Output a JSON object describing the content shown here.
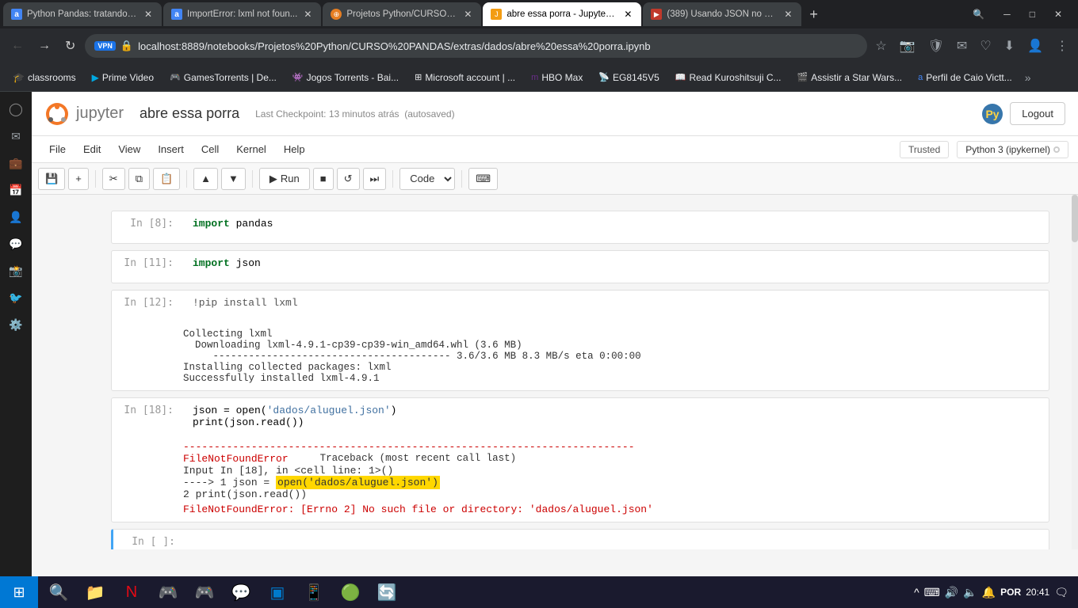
{
  "browser": {
    "tabs": [
      {
        "id": 1,
        "title": "Python Pandas: tratando e...",
        "favicon_color": "#4285f4",
        "active": false,
        "favicon_letter": "a"
      },
      {
        "id": 2,
        "title": "ImportError: lxml not foun...",
        "favicon_color": "#4285f4",
        "active": false,
        "favicon_letter": "a"
      },
      {
        "id": 3,
        "title": "Projetos Python/CURSO PA...",
        "favicon_color": "#e67e22",
        "active": false,
        "favicon_letter": "P"
      },
      {
        "id": 4,
        "title": "abre essa porra - Jupyter N...",
        "favicon_color": "#f39c12",
        "active": true,
        "favicon_letter": "J"
      },
      {
        "id": 5,
        "title": "(389) Usando JSON no Jup...",
        "favicon_color": "#c0392b",
        "active": false,
        "favicon_letter": "▶"
      }
    ],
    "url": "localhost:8889/notebooks/Projetos%20Python/CURSO%20PANDAS/extras/dados/abre%20essa%20porra.ipynb",
    "vpn_label": "VPN"
  },
  "bookmarks": [
    {
      "label": "classrooms",
      "color": "#4285f4"
    },
    {
      "label": "Prime Video",
      "color": "#00a8e0"
    },
    {
      "label": "GamesTorrents | De..."
    },
    {
      "label": "Jogos Torrents - Bai..."
    },
    {
      "label": "Microsoft account | ..."
    },
    {
      "label": "HBO Max",
      "color": "#6b2d8b"
    },
    {
      "label": "EG8145V5"
    },
    {
      "label": "Read Kuroshitsuji C..."
    },
    {
      "label": "Assistir a Star Wars..."
    },
    {
      "label": "Perfil de Caio Victt..."
    }
  ],
  "jupyter": {
    "logo_text": "jupyter",
    "notebook_title": "abre essa porra",
    "checkpoint_text": "Last Checkpoint: 13 minutos atrás",
    "autosaved": "(autosaved)",
    "logout_label": "Logout",
    "trusted_label": "Trusted",
    "kernel_label": "Python 3 (ipykernel)",
    "menu_items": [
      "File",
      "Edit",
      "View",
      "Insert",
      "Cell",
      "Kernel",
      "Help"
    ],
    "toolbar": {
      "run_label": "Run",
      "cell_type": "Code"
    }
  },
  "cells": [
    {
      "prompt": "In [8]:",
      "code": "import pandas",
      "output": "",
      "has_error": false
    },
    {
      "prompt": "In [11]:",
      "code": "import json",
      "output": "",
      "has_error": false
    },
    {
      "prompt": "In [12]:",
      "code": "!pip install lxml",
      "output": "Collecting lxml\n  Downloading lxml-4.9.1-cp39-cp39-win_amd64.whl (3.6 MB)\n     ---------------------------------------- 3.6/3.6 MB 8.3 MB/s eta 0:00:00\nInstalling collected packages: lxml\nSuccessfully installed lxml-4.9.1",
      "has_error": false
    },
    {
      "prompt": "In [18]:",
      "code_lines": [
        "json = open('dados/aluguel.json')",
        "print(json.read())"
      ],
      "error": {
        "dashes": "-------------------------------------------------------------------------",
        "error_type": "FileNotFoundError",
        "traceback_label": "Traceback (most recent call last)",
        "input_line": "Input In [18], in <cell line: 1>()",
        "arrow_line": "----> 1 json = open('dados/aluguel.json')",
        "line2": "      2 print(json.read())",
        "message": "FileNotFoundError: [Errno 2] No such file or directory: 'dados/aluguel.json'"
      },
      "has_error": true
    },
    {
      "prompt": "In [ ]:",
      "code": "",
      "output": "",
      "has_error": false,
      "is_empty": true,
      "active": true
    }
  ],
  "taskbar": {
    "time": "20:41",
    "date": "",
    "language": "POR",
    "icons": [
      "🪟",
      "📁",
      "🎬",
      "🎮",
      "🎮",
      "💬",
      "🔵",
      "💙",
      "📱",
      "🟢",
      "🔄"
    ]
  },
  "sidebar_icons": [
    "🔍",
    "📧",
    "💼",
    "📅",
    "👤",
    "💬",
    "📸",
    "🐦",
    "⚙️"
  ]
}
